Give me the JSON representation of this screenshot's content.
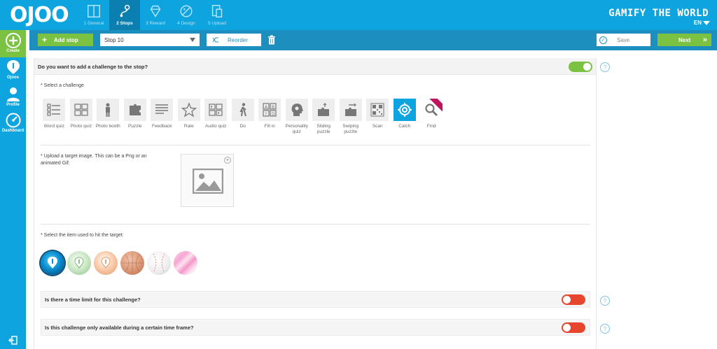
{
  "brand": {
    "logo": "OJOO",
    "tagline": "GAMIFY THE WORLD",
    "language": "EN"
  },
  "steps": [
    {
      "label": "1 General",
      "icon": "book-icon"
    },
    {
      "label": "2 Stops",
      "icon": "route-icon",
      "active": true
    },
    {
      "label": "3 Reward",
      "icon": "diamond-icon"
    },
    {
      "label": "4 Design",
      "icon": "palette-icon"
    },
    {
      "label": "5 Upload",
      "icon": "devices-icon"
    }
  ],
  "sidebar": {
    "create": "Create",
    "ojoos": "Ojoos",
    "profile": "Profile",
    "dashboard": "Dashboard"
  },
  "toolbar": {
    "add_stop": "Add stop",
    "stop_select": "Stop 10",
    "reorder": "Reorder",
    "save": "Save",
    "next": "Next"
  },
  "challenge": {
    "question": "Do you want to add a challenge to the stop?",
    "enabled": true,
    "select_label": "* Select a challenge",
    "types": [
      {
        "name": "Word quiz",
        "icon": "word-quiz-icon"
      },
      {
        "name": "Photo quiz",
        "icon": "photo-quiz-icon"
      },
      {
        "name": "Photo booth",
        "icon": "photo-booth-icon"
      },
      {
        "name": "Puzzle",
        "icon": "puzzle-icon"
      },
      {
        "name": "Feedback",
        "icon": "feedback-icon"
      },
      {
        "name": "Rate",
        "icon": "star-icon"
      },
      {
        "name": "Audio quiz",
        "icon": "audio-quiz-icon"
      },
      {
        "name": "Do",
        "icon": "walking-icon"
      },
      {
        "name": "Fill in",
        "icon": "fill-in-icon"
      },
      {
        "name": "Personality quiz",
        "icon": "head-icon"
      },
      {
        "name": "Sliding puzzle",
        "icon": "sliding-puzzle-icon"
      },
      {
        "name": "Swiping puzzle",
        "icon": "swiping-puzzle-icon"
      },
      {
        "name": "Scan",
        "icon": "qr-icon"
      },
      {
        "name": "Catch",
        "icon": "crosshair-icon",
        "active": true
      },
      {
        "name": "Find",
        "icon": "magnifier-icon"
      }
    ],
    "upload_label": "* Upload a target image. This can be a Png or an animated Gif:",
    "item_label": "* Select the item used to hit the target:",
    "items": [
      {
        "icon": "ojoo-ball-icon",
        "selected": true
      },
      {
        "icon": "green-ball-icon"
      },
      {
        "icon": "orange-ball-icon"
      },
      {
        "icon": "basketball-icon"
      },
      {
        "icon": "baseball-icon"
      },
      {
        "icon": "pink-ball-icon"
      }
    ],
    "time_limit_question": "Is there a time limit for this challenge?",
    "time_limit_enabled": false,
    "time_frame_question": "Is this challenge only available during a certain time frame?",
    "time_frame_enabled": false
  },
  "colors": {
    "primary": "#0ea4df",
    "toolbar": "#1d8fbf",
    "green": "#7cc242",
    "red": "#e8452f"
  }
}
